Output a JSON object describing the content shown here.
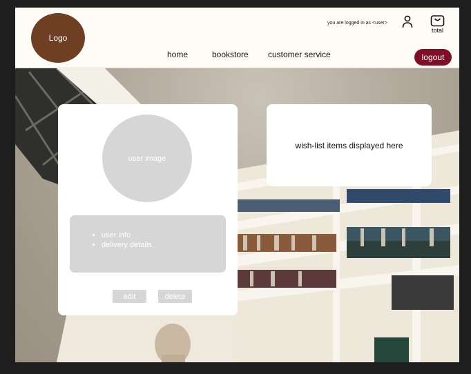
{
  "header": {
    "logo_text": "Logo",
    "login_status": "you are logged in as <user>",
    "cart_label": "total",
    "icons": {
      "user": "user-icon",
      "cart": "shopping-bag-icon"
    }
  },
  "nav": {
    "items": [
      {
        "label": "home"
      },
      {
        "label": "bookstore"
      },
      {
        "label": "customer service"
      }
    ],
    "logout_label": "logout"
  },
  "profile": {
    "image_placeholder": "user image",
    "details": [
      "user info",
      "delivery details"
    ],
    "edit_label": "edit",
    "delete_label": "delete"
  },
  "wishlist": {
    "placeholder": "wish-list items displayed here"
  },
  "colors": {
    "logo_bg": "#6e3f22",
    "logout_bg": "#7e0f25",
    "placeholder_gray": "#d6d6d6",
    "page_bg": "#1e1e1e"
  }
}
